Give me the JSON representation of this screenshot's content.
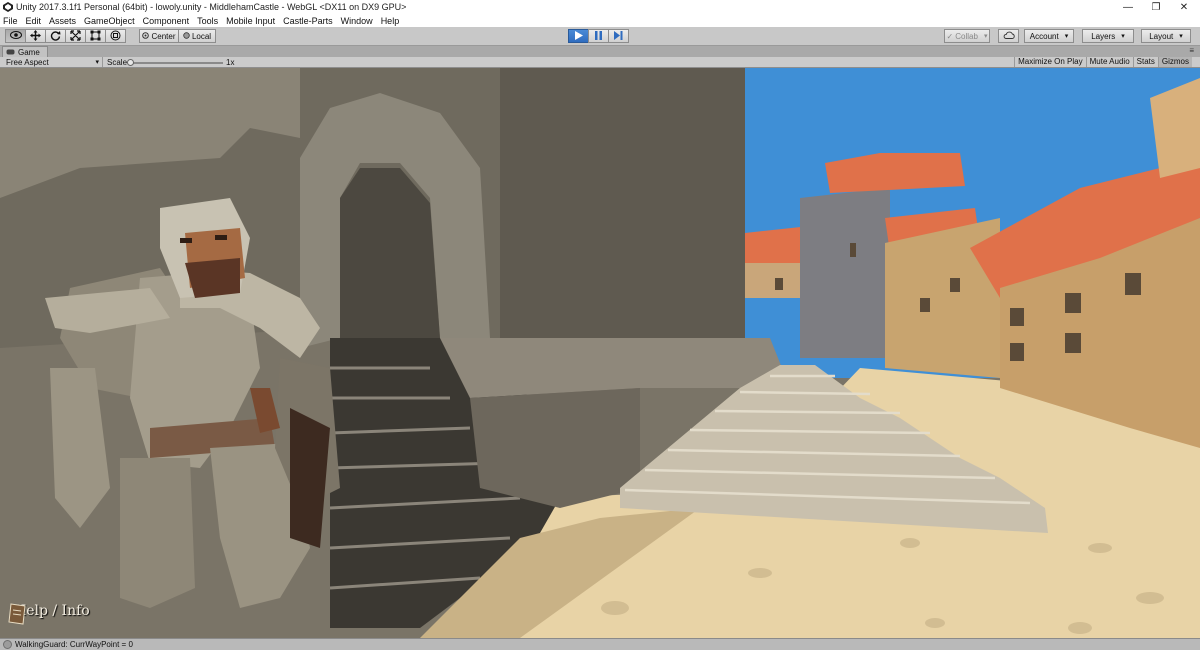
{
  "window": {
    "title": "Unity 2017.3.1f1 Personal (64bit) - lowoly.unity - MiddlehamCastle - WebGL <DX11 on DX9 GPU>",
    "minimize": "—",
    "maximize": "❐",
    "close": "✕"
  },
  "menu": [
    "File",
    "Edit",
    "Assets",
    "GameObject",
    "Component",
    "Tools",
    "Mobile Input",
    "Castle-Parts",
    "Window",
    "Help"
  ],
  "toolbar": {
    "pivot_label": "Center",
    "space_label": "Local",
    "collab_label": "Collab",
    "account_label": "Account",
    "layers_label": "Layers",
    "layout_label": "Layout",
    "play_state": "playing"
  },
  "game_tab": {
    "label": "Game",
    "aspect_label": "Free Aspect",
    "scale_label": "Scale",
    "scale_value": "1x",
    "maximize_on_play": "Maximize On Play",
    "mute_audio": "Mute Audio",
    "stats": "Stats",
    "gizmos": "Gizmos"
  },
  "game_overlay": {
    "help_label": "Help / Info"
  },
  "status": {
    "message": "WalkingGuard: CurrWayPoint = 0"
  },
  "colors": {
    "play_active": "#3a7ad0",
    "sky": "#3f8fd6",
    "roof": "#e0714a",
    "sand": "#e8d3a6"
  }
}
